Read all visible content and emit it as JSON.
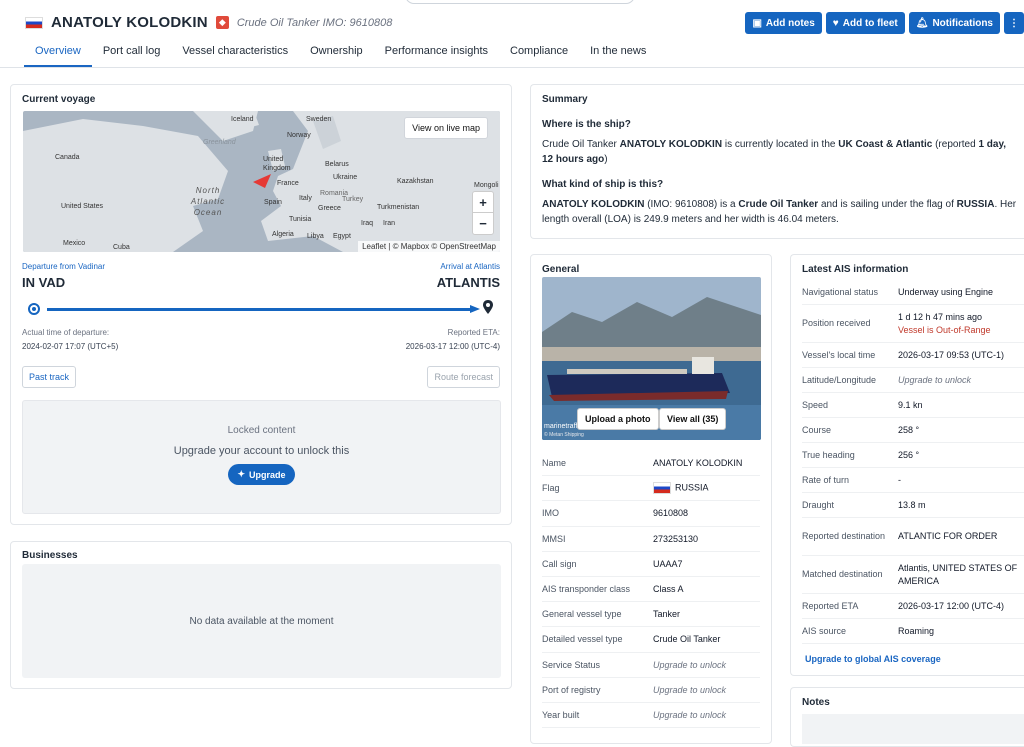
{
  "header": {
    "flag_country": "Russia",
    "ship_name": "ANATOLY KOLODKIN",
    "type_icon": "tanker-icon",
    "subtitle": "Crude Oil Tanker  IMO: 9610808",
    "tabs": [
      "Overview",
      "Port call log",
      "Vessel characteristics",
      "Ownership",
      "Performance insights",
      "Compliance",
      "In the news"
    ],
    "active_tab": 0,
    "actions": {
      "add_notes": "Add notes",
      "add_to_fleet": "Add to fleet",
      "notifications": "Notifications",
      "more": "⋮"
    }
  },
  "voyage": {
    "title": "Current voyage",
    "map_button": "View on live map",
    "map_labels": {
      "iceland": "Iceland",
      "sweden": "Sweden",
      "norway": "Norway",
      "canada": "Canada",
      "uk": "United Kingdom",
      "belarus": "Belarus",
      "ukraine": "Ukraine",
      "france": "France",
      "kazakhstan": "Kazakhstan",
      "mongolia": "Mongoli",
      "spain": "Spain",
      "italy": "Italy",
      "romania": "Romania",
      "turkey": "Turkey",
      "turkmenistan": "Turkmenistan",
      "greece": "Greece",
      "usa": "United States",
      "tunisia": "Tunisia",
      "iraq": "Iraq",
      "iran": "Iran",
      "mexico": "Mexico",
      "cuba": "Cuba",
      "algeria": "Algeria",
      "libya": "Libya",
      "egypt": "Egypt",
      "greenland": "Greenland",
      "atlantic": "North Atlantic Ocean"
    },
    "zoom_in": "+",
    "zoom_out": "−",
    "attribution": "Leaflet | © Mapbox © OpenStreetMap",
    "departure_label": "Departure from Vadinar",
    "departure_code": "IN VAD",
    "arrival_label": "Arrival at Atlantis",
    "arrival_code": "ATLANTIS",
    "progress": 1.0,
    "atd_label": "Actual time of departure:",
    "atd_value": "2024-02-07 17:07 (UTC+5)",
    "eta_label": "Reported ETA:",
    "eta_value": "2026-03-17 12:00 (UTC-4)",
    "past_track": "Past track",
    "route_forecast": "Route forecast",
    "locked_title": "Locked content",
    "locked_msg": "Upgrade your account to unlock this",
    "upgrade": "Upgrade"
  },
  "businesses": {
    "title": "Businesses",
    "empty": "No data available at the moment"
  },
  "summary": {
    "title": "Summary",
    "q1": "Where is the ship?",
    "a1_pre": "Crude Oil Tanker ",
    "a1_name": "ANATOLY KOLODKIN",
    "a1_mid": " is currently located in the ",
    "a1_area": "UK Coast & Atlantic",
    "a1_rep": " (reported ",
    "a1_time": "1 day, 12 hours ago",
    "a1_end": ")",
    "q2": "What kind of ship is this?",
    "a2_name": "ANATOLY KOLODKIN",
    "a2_imo": " (IMO: 9610808) is a ",
    "a2_type": "Crude Oil Tanker",
    "a2_flag_pre": " and is sailing under the flag of ",
    "a2_flag": "RUSSIA",
    "a2_end": ". Her length overall (LOA) is 249.9 meters and her width is 46.04 meters."
  },
  "general": {
    "title": "General",
    "photo_watermark": "marinetraffic",
    "photo_credit": "© Metan Shipping",
    "upload_photo": "Upload a photo",
    "view_all": "View all (35)",
    "rows": [
      {
        "k": "Name",
        "v": "ANATOLY KOLODKIN"
      },
      {
        "k": "Flag",
        "v": "RUSSIA"
      },
      {
        "k": "IMO",
        "v": "9610808"
      },
      {
        "k": "MMSI",
        "v": "273253130"
      },
      {
        "k": "Call sign",
        "v": "UAAA7"
      },
      {
        "k": "AIS transponder class",
        "v": "Class A"
      },
      {
        "k": "General vessel type",
        "v": "Tanker"
      },
      {
        "k": "Detailed vessel type",
        "v": "Crude Oil Tanker"
      },
      {
        "k": "Service Status",
        "v": "Upgrade to unlock"
      },
      {
        "k": "Port of registry",
        "v": "Upgrade to unlock"
      },
      {
        "k": "Year built",
        "v": "Upgrade to unlock"
      }
    ]
  },
  "ais": {
    "title": "Latest AIS information",
    "rows": [
      {
        "k": "Navigational status",
        "v": "Underway using Engine"
      },
      {
        "k": "Position received",
        "v": "1 d 12 h 47 mins ago",
        "v2": "Vessel is Out-of-Range"
      },
      {
        "k": "Vessel's local time",
        "v": "2026-03-17 09:53 (UTC-1)"
      },
      {
        "k": "Latitude/Longitude",
        "v": "Upgrade to unlock"
      },
      {
        "k": "Speed",
        "v": "9.1 kn"
      },
      {
        "k": "Course",
        "v": "258 °"
      },
      {
        "k": "True heading",
        "v": "256 °"
      },
      {
        "k": "Rate of turn",
        "v": "-"
      },
      {
        "k": "Draught",
        "v": "13.8 m"
      },
      {
        "k": "Reported destination",
        "v": "ATLANTIC FOR ORDER"
      },
      {
        "k": "Matched destination",
        "v": "Atlantis, UNITED STATES OF AMERICA"
      },
      {
        "k": "Reported ETA",
        "v": "2026-03-17 12:00 (UTC-4)"
      },
      {
        "k": "AIS source",
        "v": "Roaming"
      }
    ],
    "upgrade_link": "Upgrade to global AIS coverage"
  },
  "notes": {
    "title": "Notes"
  },
  "colors": {
    "primary": "#1565c0",
    "link": "#1a66c2",
    "warn": "#c0392b"
  }
}
